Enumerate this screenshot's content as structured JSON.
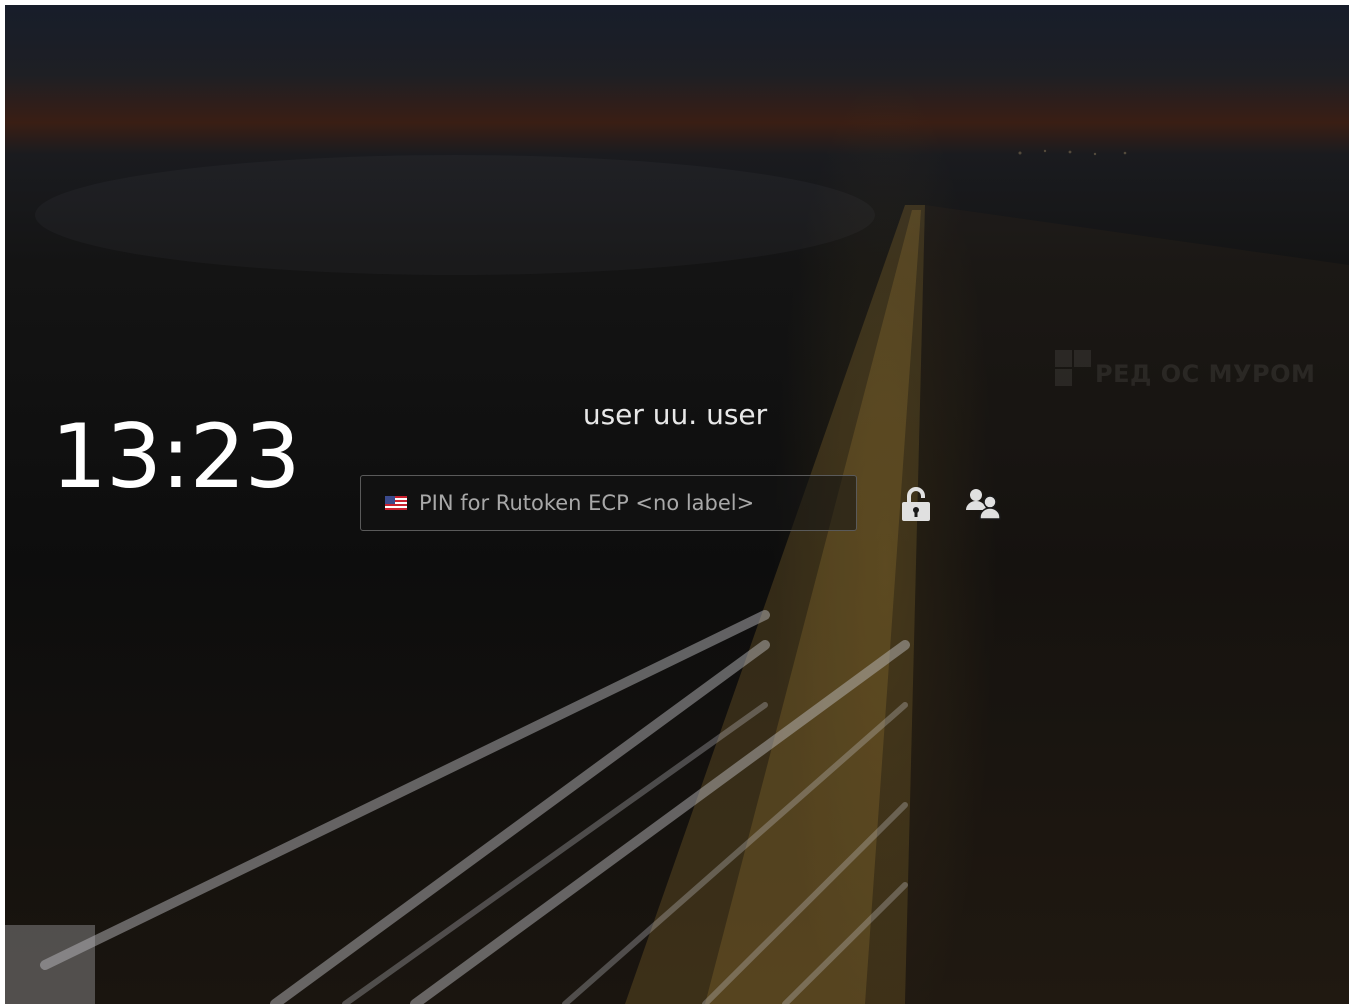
{
  "clock": {
    "time": "13:23"
  },
  "user": {
    "display_name": "user uu. user"
  },
  "login": {
    "pin_placeholder": "PIN for Rutoken ECP <no label>",
    "keyboard_layout_icon": "us-flag-icon"
  },
  "actions": {
    "unlock_icon": "unlock-icon",
    "switch_user_icon": "users-icon"
  },
  "watermark": {
    "text": "РЕД ОС МУРОМ"
  },
  "colors": {
    "text_primary": "#ffffff",
    "text_secondary": "#a8a8a8",
    "field_border": "#5a5a5a",
    "icon": "#e0e0e0"
  }
}
